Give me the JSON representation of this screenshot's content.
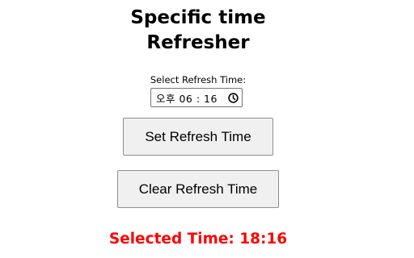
{
  "app": {
    "title_line1": "Specific time",
    "title_line2": "Refresher"
  },
  "picker": {
    "label": "Select Refresh Time:",
    "value_display": "오후  06 : 16",
    "icon": "clock-icon"
  },
  "buttons": {
    "set_label": "Set Refresh Time",
    "clear_label": "Clear Refresh Time"
  },
  "status": {
    "selected_time_text": "Selected Time: 18:16"
  },
  "colors": {
    "status_text": "#ff0000",
    "button_bg": "#f0f0f0",
    "button_border": "#8f8f8f",
    "page_bg": "#ffffff"
  }
}
